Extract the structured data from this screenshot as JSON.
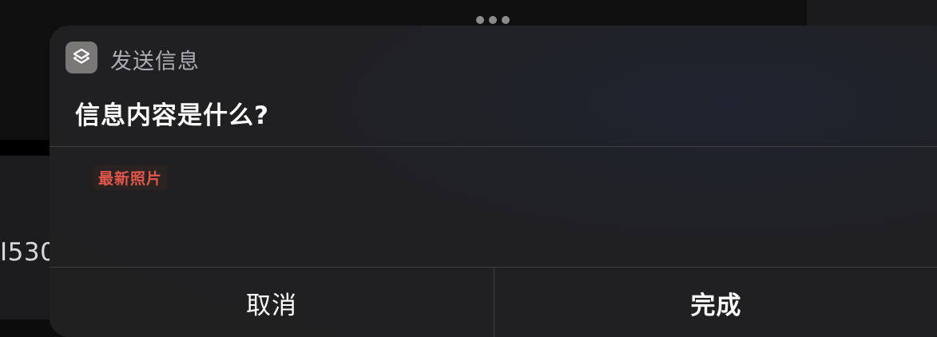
{
  "background": {
    "fragment_text": "I530"
  },
  "dialog": {
    "app_name": "发送信息",
    "app_icon": "shortcuts-icon",
    "question": "信息内容是什么?",
    "token_label": "最新照片",
    "cancel_label": "取消",
    "done_label": "完成"
  },
  "colors": {
    "token_text": "#e2574c",
    "sheet_bg": "#202021"
  }
}
